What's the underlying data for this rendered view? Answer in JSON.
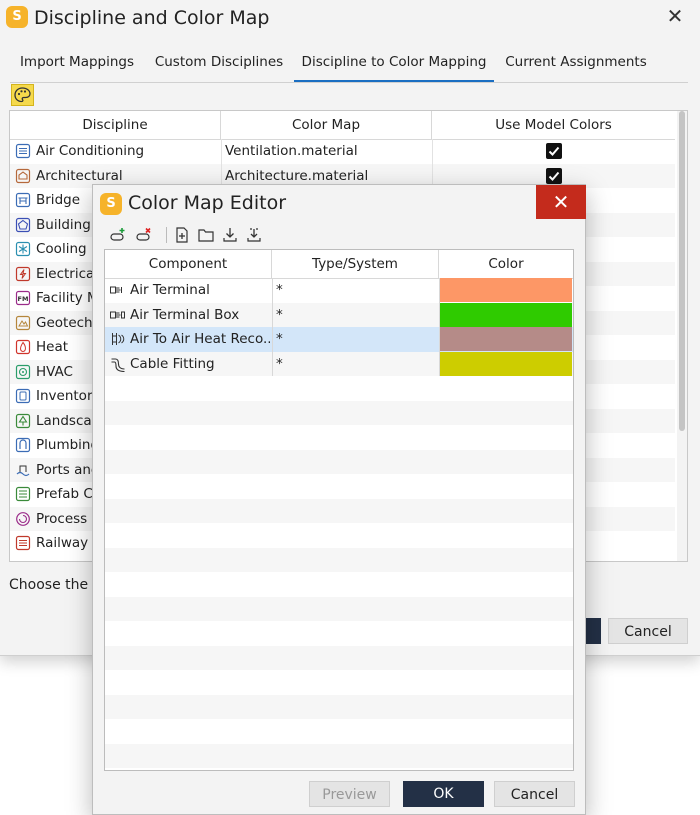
{
  "window": {
    "logo_letter": "S",
    "title": "Discipline and Color Map",
    "close_glyph": "✕"
  },
  "tabs": [
    {
      "label": "Import Mappings",
      "active": false
    },
    {
      "label": "Custom Disciplines",
      "active": false
    },
    {
      "label": "Discipline to Color Mapping",
      "active": true
    },
    {
      "label": "Current Assignments",
      "active": false
    }
  ],
  "toolbar": {
    "palette_icon": "palette-icon"
  },
  "discipline_grid": {
    "columns": [
      "Discipline",
      "Color Map",
      "Use Model Colors"
    ],
    "rows": [
      {
        "discipline": "Air Conditioning",
        "icon": "air-conditioning-icon",
        "color_map": "Ventilation.material",
        "use_model_colors": true
      },
      {
        "discipline": "Architectural",
        "icon": "architectural-icon",
        "color_map": "Architecture.material",
        "use_model_colors": true
      },
      {
        "discipline": "Bridge",
        "icon": "bridge-icon",
        "color_map": "",
        "use_model_colors": false
      },
      {
        "discipline": "Building",
        "icon": "building-icon",
        "color_map": "",
        "use_model_colors": false
      },
      {
        "discipline": "Cooling",
        "icon": "cooling-icon",
        "color_map": "",
        "use_model_colors": false
      },
      {
        "discipline": "Electrical",
        "icon": "electrical-icon",
        "color_map": "",
        "use_model_colors": false
      },
      {
        "discipline": "Facility M",
        "icon": "facility-management-icon",
        "color_map": "",
        "use_model_colors": false
      },
      {
        "discipline": "Geotechi",
        "icon": "geotechnical-icon",
        "color_map": "",
        "use_model_colors": false
      },
      {
        "discipline": "Heat",
        "icon": "heat-icon",
        "color_map": "",
        "use_model_colors": false
      },
      {
        "discipline": "HVAC",
        "icon": "hvac-icon",
        "color_map": "",
        "use_model_colors": false
      },
      {
        "discipline": "Inventor",
        "icon": "inventory-icon",
        "color_map": "",
        "use_model_colors": false
      },
      {
        "discipline": "Landscap",
        "icon": "landscape-icon",
        "color_map": "",
        "use_model_colors": false
      },
      {
        "discipline": "Plumbing",
        "icon": "plumbing-icon",
        "color_map": "",
        "use_model_colors": false
      },
      {
        "discipline": "Ports and",
        "icon": "ports-icon",
        "color_map": "",
        "use_model_colors": false
      },
      {
        "discipline": "Prefab Co",
        "icon": "prefab-icon",
        "color_map": "",
        "use_model_colors": false
      },
      {
        "discipline": "Process",
        "icon": "process-icon",
        "color_map": "",
        "use_model_colors": false
      },
      {
        "discipline": "Railway",
        "icon": "railway-icon",
        "color_map": "",
        "use_model_colors": false
      }
    ]
  },
  "status_text": "Choose the d",
  "footer": {
    "cancel_label": "Cancel"
  },
  "modal": {
    "logo_letter": "S",
    "title": "Color Map Editor",
    "close_glyph": "✕",
    "toolbar_icons": [
      "add-row-icon",
      "remove-row-icon",
      "new-file-icon",
      "open-folder-icon",
      "download-icon",
      "import-icon"
    ],
    "columns": [
      "Component",
      "Type/System",
      "Color"
    ],
    "rows": [
      {
        "component": "Air Terminal",
        "icon": "air-terminal-icon",
        "type_system": "*",
        "color": "#fd9766",
        "selected": false
      },
      {
        "component": "Air Terminal Box",
        "icon": "air-terminal-box-icon",
        "type_system": "*",
        "color": "#2fcb00",
        "selected": false
      },
      {
        "component": "Air To Air Heat Reco...",
        "icon": "heat-recovery-icon",
        "type_system": "*",
        "color": "#b58b88",
        "selected": true
      },
      {
        "component": "Cable Fitting",
        "icon": "cable-fitting-icon",
        "type_system": "*",
        "color": "#cdcd00",
        "selected": false
      }
    ],
    "buttons": {
      "preview": "Preview",
      "ok": "OK",
      "cancel": "Cancel"
    }
  }
}
